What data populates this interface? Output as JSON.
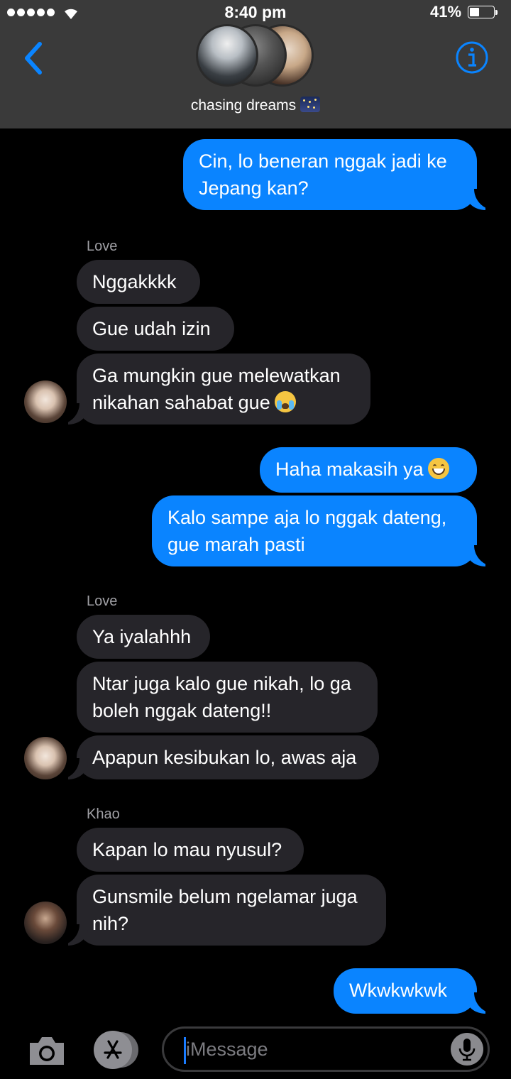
{
  "status_bar": {
    "time": "8:40 pm",
    "battery_percent": "41%",
    "battery_level": 0.41,
    "signal_dots": 5
  },
  "header": {
    "group_name": "chasing dreams",
    "group_emoji": "night-with-stars-icon",
    "back_icon": "chevron-left-icon",
    "info_icon": "info-icon",
    "accent_color": "#0a84ff"
  },
  "messages": [
    {
      "direction": "out",
      "text": "Cin, lo beneran nggak jadi ke Jepang kan?"
    },
    {
      "direction": "in",
      "sender": "Love",
      "text": "Nggakkkk"
    },
    {
      "direction": "in",
      "text": "Gue udah izin"
    },
    {
      "direction": "in",
      "text": "Ga mungkin gue melewatkan nikahan sahabat gue",
      "emoji": "loudly-crying-face"
    },
    {
      "direction": "out",
      "text": "Haha makasih ya",
      "emoji": "grinning-face"
    },
    {
      "direction": "out",
      "text": "Kalo sampe aja lo nggak dateng, gue marah pasti"
    },
    {
      "direction": "in",
      "sender": "Love",
      "text": "Ya iyalahhh"
    },
    {
      "direction": "in",
      "text": "Ntar juga kalo gue nikah, lo ga boleh nggak dateng!!"
    },
    {
      "direction": "in",
      "text": "Apapun kesibukan lo, awas aja"
    },
    {
      "direction": "in",
      "sender": "Khao",
      "text": "Kapan lo mau nyusul?"
    },
    {
      "direction": "in",
      "text": "Gunsmile belum ngelamar juga nih?"
    },
    {
      "direction": "out",
      "text": "Wkwkwkwk"
    }
  ],
  "colors": {
    "outgoing_bubble": "#0a84ff",
    "incoming_bubble": "#26252a",
    "header_bg": "#3a3a3a",
    "background": "#000000"
  },
  "input": {
    "placeholder": "iMessage",
    "value": ""
  }
}
